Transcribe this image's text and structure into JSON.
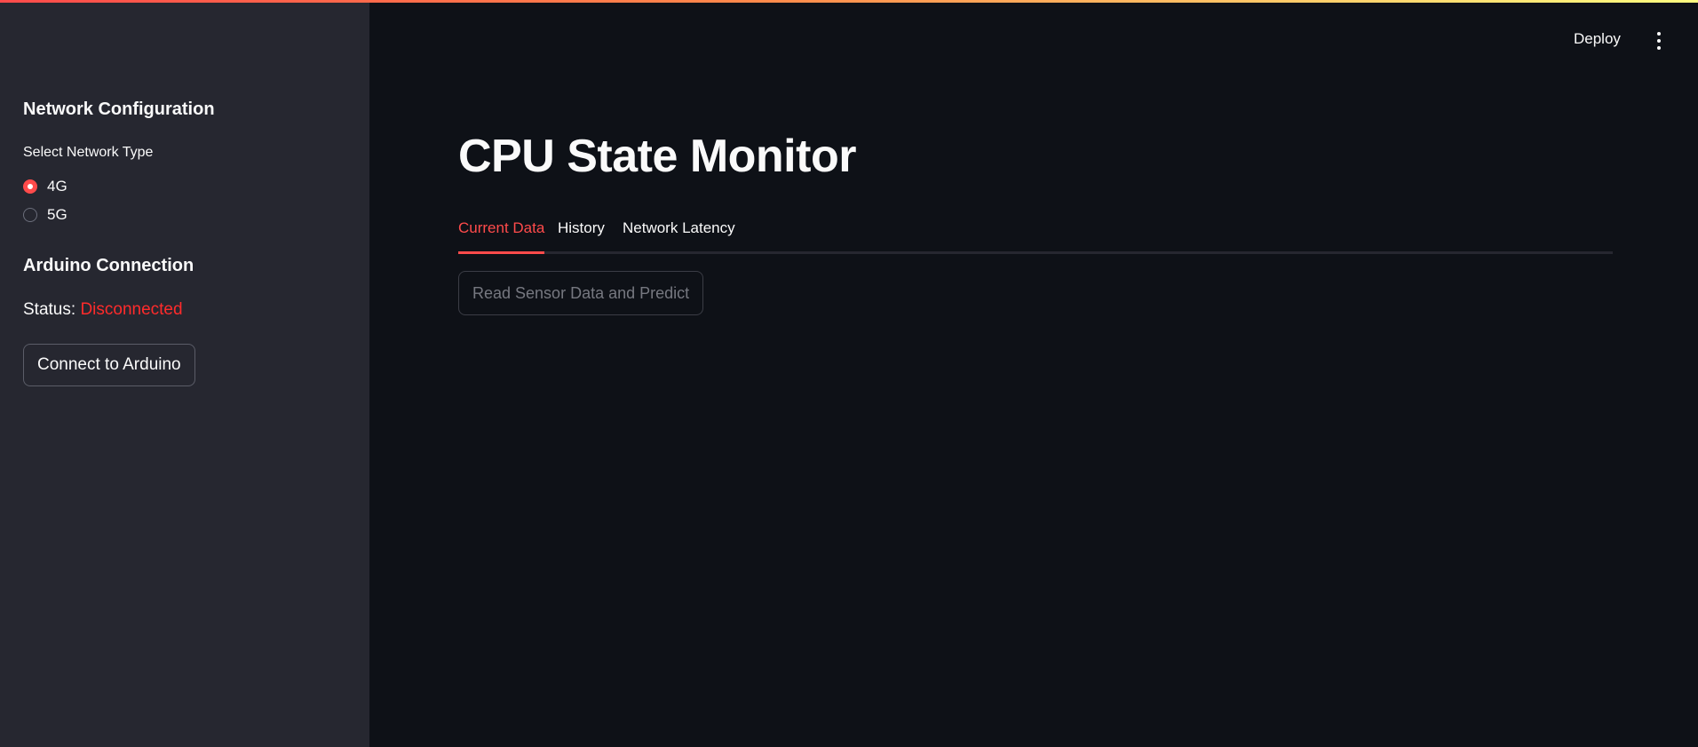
{
  "colors": {
    "primary_accent": "#ff4b4b",
    "status_error": "#ff2b2b",
    "sidebar_bg": "#262730",
    "main_bg": "#0e1117"
  },
  "toolbar": {
    "deploy_label": "Deploy",
    "menu_icon": "more-vertical-icon"
  },
  "sidebar": {
    "network_title": "Network Configuration",
    "network_type_label": "Select Network Type",
    "network_options": [
      {
        "label": "4G",
        "selected": true
      },
      {
        "label": "5G",
        "selected": false
      }
    ],
    "arduino_title": "Arduino Connection",
    "status_label": "Status:",
    "status_value": "Disconnected",
    "connect_button_label": "Connect to Arduino"
  },
  "main": {
    "title": "CPU State Monitor",
    "tabs": [
      {
        "label": "Current Data",
        "active": true
      },
      {
        "label": "History",
        "active": false
      },
      {
        "label": "Network Latency",
        "active": false
      }
    ],
    "predict_button_label": "Read Sensor Data and Predict"
  }
}
